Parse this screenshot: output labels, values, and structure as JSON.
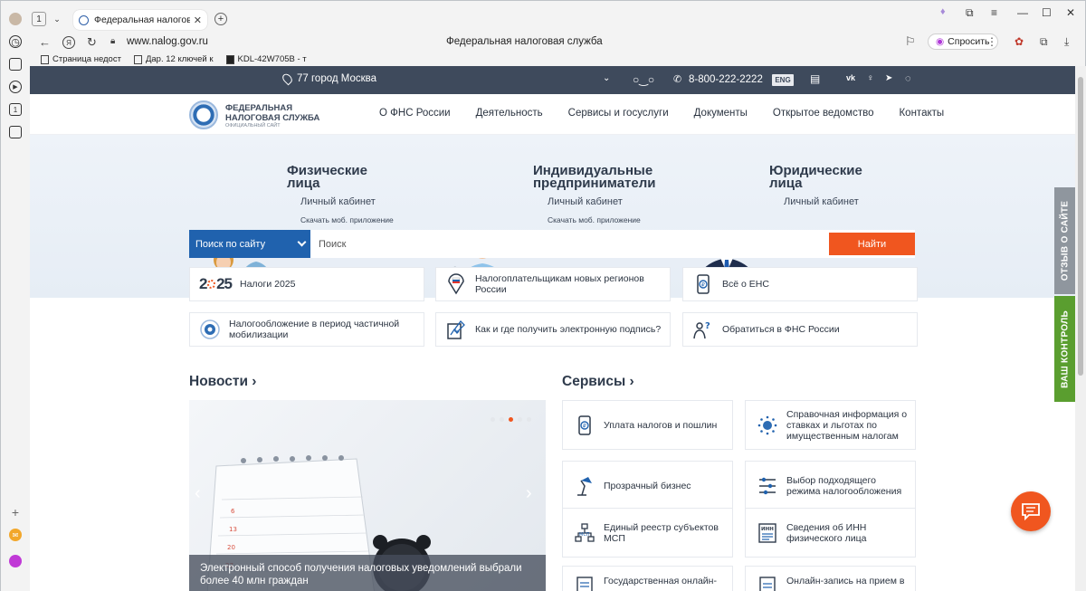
{
  "browser": {
    "tab_count": "1",
    "tab_title": "Федеральная налоговая",
    "url": "www.nalog.gov.ru",
    "page_title": "Федеральная налоговая служба",
    "ask_label": "Спросить",
    "bookmarks": [
      "Страница недост",
      "Дар. 12 ключей к",
      "KDL-42W705B - т"
    ]
  },
  "topbar": {
    "city": "77 город Москва",
    "phone": "8-800-222-2222",
    "lang": "ENG"
  },
  "logo": {
    "line1": "ФЕДЕРАЛЬНАЯ",
    "line2": "НАЛОГОВАЯ СЛУЖБА",
    "line3": "ОФИЦИАЛЬНЫЙ САЙТ"
  },
  "nav": [
    "О ФНС России",
    "Деятельность",
    "Сервисы и госуслуги",
    "Документы",
    "Открытое ведомство",
    "Контакты"
  ],
  "hero": {
    "individuals": {
      "title1": "Физические",
      "title2": "лица",
      "cabinet": "Личный кабинет",
      "app": "Скачать моб. приложение"
    },
    "entrepreneurs": {
      "title1": "Индивидуальные",
      "title2": "предприниматели",
      "cabinet": "Личный кабинет",
      "app": "Скачать моб. приложение"
    },
    "legal": {
      "title1": "Юридические",
      "title2": "лица",
      "cabinet": "Личный кабинет"
    }
  },
  "search": {
    "scope": "Поиск по сайту",
    "placeholder": "Поиск",
    "button": "Найти"
  },
  "quick_links": [
    {
      "icon": "2025-icon",
      "year_left": "2",
      "year_right": "25",
      "text": "Налоги 2025"
    },
    {
      "icon": "map-pin-flag-icon",
      "text1": "Налогоплательщикам новых регионов",
      "text2": "России"
    },
    {
      "icon": "ens-phone-icon",
      "text": "Всё о ЕНС"
    },
    {
      "icon": "emblem-icon",
      "text1": "Налогообложение в период частичной",
      "text2": "мобилизации"
    },
    {
      "icon": "digital-signature-icon",
      "text": "Как и где получить электронную подпись?"
    },
    {
      "icon": "question-person-icon",
      "text": "Обратиться в ФНС России"
    }
  ],
  "news": {
    "heading": "Новости",
    "caption1": "Электронный способ получения налоговых уведомлений выбрали",
    "caption2": "более 40 млн граждан"
  },
  "services": {
    "heading": "Сервисы",
    "items": [
      {
        "icon": "ruble-phone-icon",
        "text1": "Уплата налогов и пошлин",
        "text2": ""
      },
      {
        "icon": "emblem-dots-icon",
        "text1": "Справочная информация о",
        "text2": "ставках и льготах по",
        "text3": "имущественным налогам"
      },
      {
        "icon": "lamp-icon",
        "text1": "Прозрачный бизнес",
        "text2": ""
      },
      {
        "icon": "sliders-icon",
        "text1": "Выбор подходящего",
        "text2": "режима налогообложения"
      },
      {
        "icon": "network-icon",
        "text1": "Единый реестр субъектов",
        "text2": "МСП"
      },
      {
        "icon": "inn-doc-icon",
        "text1": "Сведения об ИНН",
        "text2": "физического лица",
        "badge": "ИНН"
      },
      {
        "icon": "kkt-icon",
        "text1": "Государственная онлайн-",
        "text2": ""
      },
      {
        "icon": "m02-doc-icon",
        "text1": "Онлайн-запись на прием в",
        "text2": ""
      }
    ]
  },
  "side_tabs": {
    "feedback": "ОТЗЫВ О САЙТЕ",
    "control": "ВАШ КОНТРОЛЬ"
  },
  "colors": {
    "topbar": "#3e4a5c",
    "search_scope": "#2062ae",
    "accent": "#f0561f",
    "control_tab": "#5a9e2f"
  }
}
